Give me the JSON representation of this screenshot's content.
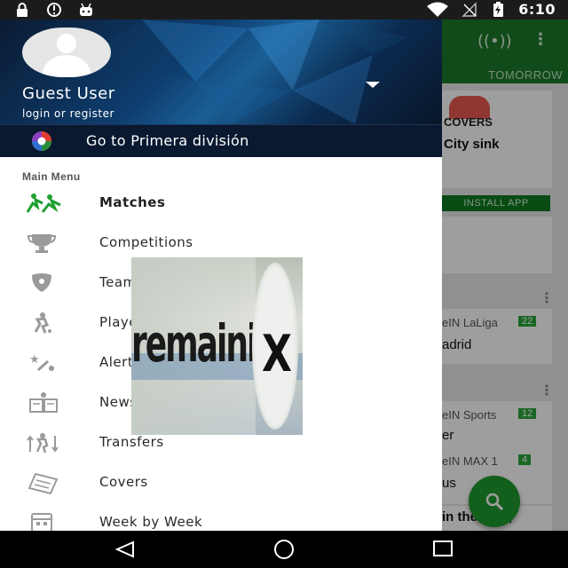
{
  "status_bar": {
    "time": "6:10",
    "left_icons": [
      "lock-icon",
      "info-icon",
      "android-icon"
    ],
    "right_icons": [
      "wifi-icon",
      "no-signal-icon",
      "battery-charging-icon"
    ]
  },
  "background_app": {
    "tab_label": "TOMORROW",
    "covers_label": "COVERS",
    "card_headline_1": "City sink",
    "install_label": "INSTALL APP",
    "channel_1": "eIN LaLiga",
    "channel_1_count": "22",
    "team_1": "adrid",
    "channel_2": "eIN Sports",
    "channel_2_count": "12",
    "team_2": "er",
    "channel_3": "eIN MAX 1",
    "channel_3_count": "4",
    "team_3": "us",
    "card_headline_2": "in the past,",
    "accent_color": "#1e7a2a"
  },
  "drawer": {
    "user_name": "Guest User",
    "user_sub": "login or register",
    "league_link": "Go to Primera división",
    "section_title": "Main Menu",
    "items": [
      {
        "label": "Matches",
        "icon": "players-running-icon",
        "active": true
      },
      {
        "label": "Competitions",
        "icon": "trophy-icon",
        "active": false
      },
      {
        "label": "Teams",
        "icon": "shield-icon",
        "active": false
      },
      {
        "label": "Players",
        "icon": "player-kicking-icon",
        "active": false
      },
      {
        "label": "Alerts",
        "icon": "alerts-icon",
        "active": false
      },
      {
        "label": "News",
        "icon": "newspaper-icon",
        "active": false
      },
      {
        "label": "Transfers",
        "icon": "transfers-icon",
        "active": false
      },
      {
        "label": "Covers",
        "icon": "covers-icon",
        "active": false
      },
      {
        "label": "Week by Week",
        "icon": "calendar-icon",
        "active": false
      }
    ]
  },
  "overlay_ad": {
    "text": "remaining",
    "close_glyph": "X"
  },
  "nav_bar": {
    "buttons": [
      "back-icon",
      "home-icon",
      "recents-icon"
    ]
  }
}
